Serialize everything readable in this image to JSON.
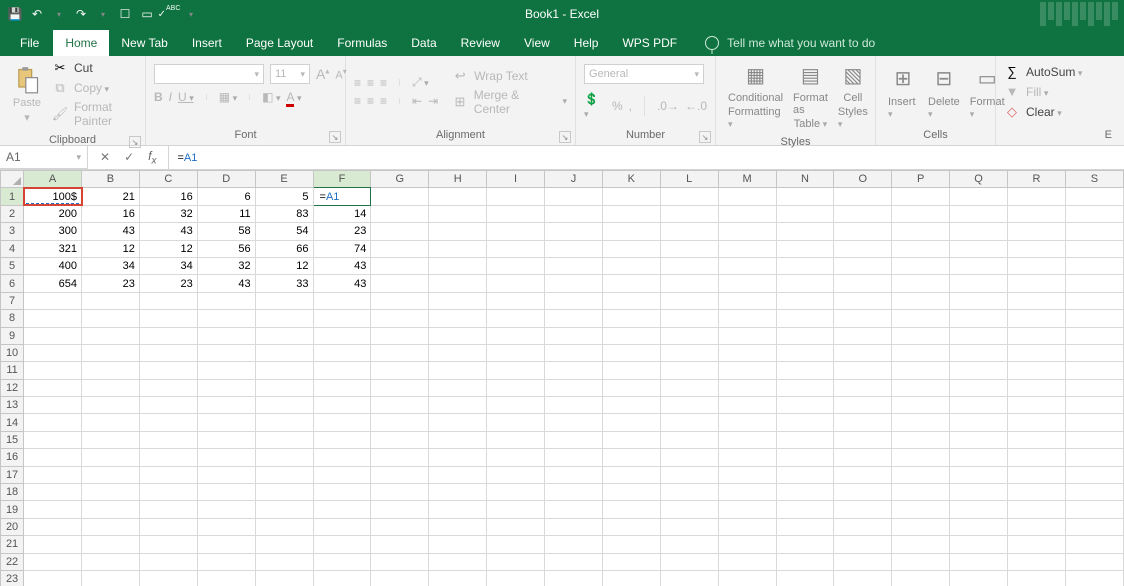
{
  "title": "Book1  -  Excel",
  "qat_icons": [
    "save",
    "undo",
    "redo",
    "touch",
    "new",
    "spellcheck",
    "customize"
  ],
  "tabs": {
    "file": "File",
    "home": "Home",
    "newtab": "New Tab",
    "insert": "Insert",
    "pagelayout": "Page Layout",
    "formulas": "Formulas",
    "data": "Data",
    "review": "Review",
    "view": "View",
    "help": "Help",
    "wps": "WPS PDF"
  },
  "tellme": "Tell me what you want to do",
  "ribbon": {
    "clipboard": {
      "label": "Clipboard",
      "paste": "Paste",
      "cut": "Cut",
      "copy": "Copy",
      "fmtpainter": "Format Painter"
    },
    "font": {
      "label": "Font",
      "size": "11",
      "b": "B",
      "i": "I",
      "u": "U"
    },
    "alignment": {
      "label": "Alignment",
      "wrap": "Wrap Text",
      "merge": "Merge & Center"
    },
    "number": {
      "label": "Number",
      "general": "General"
    },
    "styles": {
      "label": "Styles",
      "cond": "Conditional",
      "cond2": "Formatting",
      "fmtas": "Format as",
      "fmtas2": "Table",
      "cellst": "Cell",
      "cellst2": "Styles"
    },
    "cells": {
      "label": "Cells",
      "insert": "Insert",
      "delete": "Delete",
      "format": "Format"
    },
    "editing": {
      "autosum": "AutoSum",
      "fill": "Fill",
      "clear": "Clear"
    }
  },
  "namebox": "A1",
  "formula_prefix": "=",
  "formula_ref": "A1",
  "columns": [
    "A",
    "B",
    "C",
    "D",
    "E",
    "F",
    "G",
    "H",
    "I",
    "J",
    "K",
    "L",
    "M",
    "N",
    "O",
    "P",
    "Q",
    "R",
    "S"
  ],
  "rows": 23,
  "data": {
    "1": {
      "A": "100$",
      "B": "21",
      "C": "16",
      "D": "6",
      "E": "5"
    },
    "2": {
      "A": "200",
      "B": "16",
      "C": "32",
      "D": "11",
      "E": "83",
      "F": "14"
    },
    "3": {
      "A": "300",
      "B": "43",
      "C": "43",
      "D": "58",
      "E": "54",
      "F": "23"
    },
    "4": {
      "A": "321",
      "B": "12",
      "C": "12",
      "D": "56",
      "E": "66",
      "F": "74"
    },
    "5": {
      "A": "400",
      "B": "34",
      "C": "34",
      "D": "32",
      "E": "12",
      "F": "43"
    },
    "6": {
      "A": "654",
      "B": "23",
      "C": "23",
      "D": "43",
      "E": "33",
      "F": "43"
    }
  },
  "edit": {
    "row": 1,
    "col": "F",
    "text_prefix": "=",
    "text_ref": "A1"
  },
  "refcell": {
    "row": 1,
    "col": "A"
  },
  "status_right": "E"
}
